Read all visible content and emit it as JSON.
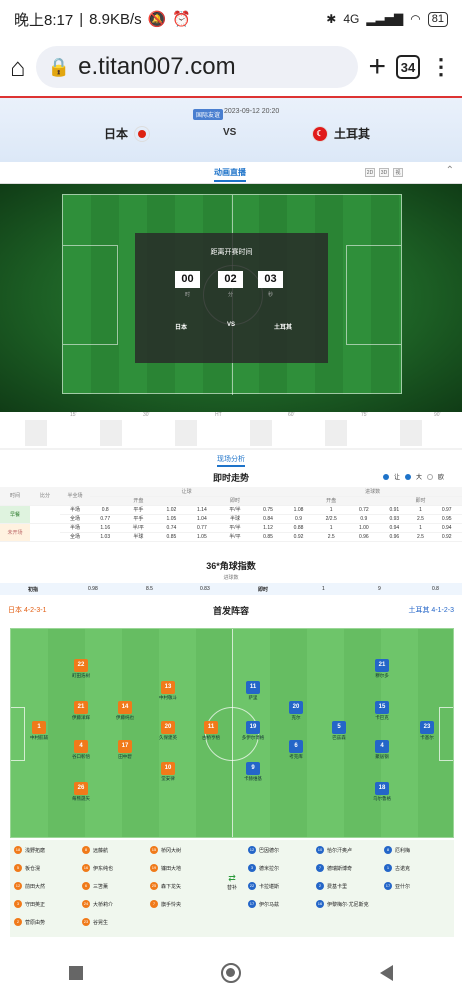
{
  "status_bar": {
    "time": "晚上8:17",
    "speed": "8.9KB/s",
    "network": "4G",
    "battery": "81"
  },
  "browser": {
    "url": "e.titan007.com",
    "tab_count": "34"
  },
  "match": {
    "league": "国际友谊",
    "datetime": "2023-09-12 20:20",
    "home": "日本",
    "away": "土耳其",
    "vs": "VS"
  },
  "live": {
    "tab": "动画直播",
    "view_buttons": [
      "2D",
      "3D",
      "视"
    ]
  },
  "countdown": {
    "title": "距离开赛时间",
    "boxes": [
      {
        "value": "00",
        "unit": "时"
      },
      {
        "value": "02",
        "unit": "分"
      },
      {
        "value": "03",
        "unit": "秒"
      }
    ],
    "home": "日本",
    "vs": "VS",
    "away": "土耳其"
  },
  "timeline_ticks": [
    "15'",
    "30'",
    "HT",
    "60'",
    "75'",
    "90'"
  ],
  "analysis": {
    "tab": "现场分析",
    "title": "即时走势",
    "radios": [
      {
        "label": "让",
        "on": true
      },
      {
        "label": "大",
        "on": true
      },
      {
        "label": "欧",
        "on": false
      }
    ],
    "head1": [
      "时间",
      "比分",
      "半全场",
      "让球",
      "进球数"
    ],
    "head2": [
      "开盘",
      "即时",
      "开盘",
      "即时"
    ],
    "rows": [
      {
        "phase": "早餐",
        "half": "半场",
        "cells": [
          "0.8",
          "平手",
          "1.02",
          "1.14",
          "平/半",
          "0.75",
          "1.08",
          "1",
          "0.72",
          "0.91",
          "1",
          "0.97"
        ]
      },
      {
        "phase": "",
        "half": "全场",
        "cells": [
          "0.77",
          "平手",
          "1.05",
          "1.04",
          "半球",
          "0.84",
          "0.9",
          "2/2.5",
          "0.9",
          "0.93",
          "2.5",
          "0.95"
        ]
      },
      {
        "phase": "未开场",
        "half": "半场",
        "cells": [
          "1.16",
          "半/平",
          "0.74",
          "0.77",
          "平/半",
          "1.12",
          "0.88",
          "1",
          "1.00",
          "0.94",
          "1",
          "0.94"
        ]
      },
      {
        "phase": "",
        "half": "全场",
        "cells": [
          "1.03",
          "半球",
          "0.85",
          "1.05",
          "半/平",
          "0.85",
          "0.92",
          "2.5",
          "0.96",
          "0.96",
          "2.5",
          "0.92"
        ]
      }
    ]
  },
  "corner": {
    "title": "36*角球指数",
    "sub": "进球数",
    "row": {
      "label1": "初指",
      "v": [
        "0.98",
        "8.5",
        "0.83"
      ],
      "label2": "即时",
      "w": [
        "1",
        "9",
        "0.8"
      ]
    }
  },
  "lineup": {
    "title": "首发阵容",
    "home_formation": "日本 4-2-3-1",
    "away_formation": "土耳其 4-1-2-3",
    "home_players": [
      {
        "n": "1",
        "name": "中村航辅"
      },
      {
        "n": "21",
        "name": "伊藤洋辉"
      },
      {
        "n": "4",
        "name": "谷口彰悟"
      },
      {
        "n": "22",
        "name": "町田浩树"
      },
      {
        "n": "26",
        "name": "毎熊晟矢"
      },
      {
        "n": "14",
        "name": "伊藤纯也"
      },
      {
        "n": "17",
        "name": "田中碧"
      },
      {
        "n": "13",
        "name": "中村敬斗"
      },
      {
        "n": "20",
        "name": "久保建英"
      },
      {
        "n": "10",
        "name": "堂安律"
      },
      {
        "n": "11",
        "name": "古桥亨梧"
      }
    ],
    "away_players": [
      {
        "n": "23",
        "name": "卡基尔"
      },
      {
        "n": "21",
        "name": "穆尔多"
      },
      {
        "n": "15",
        "name": "卡巴克"
      },
      {
        "n": "4",
        "name": "聚居钢"
      },
      {
        "n": "18",
        "name": "乌尔鲁格"
      },
      {
        "n": "5",
        "name": "巴兹森"
      },
      {
        "n": "20",
        "name": "克尔"
      },
      {
        "n": "6",
        "name": "考克库"
      },
      {
        "n": "11",
        "name": "萨里"
      },
      {
        "n": "19",
        "name": "多伊尔博格"
      },
      {
        "n": "9",
        "name": "卡赫维基"
      }
    ],
    "subs_label": "替补",
    "home_subs": [
      {
        "n": "18",
        "name": "浅野拓磨"
      },
      {
        "n": "8",
        "name": "远藤航"
      },
      {
        "n": "15",
        "name": "桥冈大树"
      },
      {
        "n": "5",
        "name": "板仓滉"
      },
      {
        "n": "16",
        "name": "伊东纯也"
      },
      {
        "n": "19",
        "name": "镰田大地"
      },
      {
        "n": "12",
        "name": "前田大然"
      },
      {
        "n": "6",
        "name": "三笘薰"
      },
      {
        "n": "25",
        "name": "森下龙矢"
      },
      {
        "n": "3",
        "name": "守田英正"
      },
      {
        "n": "24",
        "name": "大桥莉介"
      },
      {
        "n": "7",
        "name": "旗手怜央"
      },
      {
        "n": "2",
        "name": "菅原由势"
      },
      {
        "n": "23",
        "name": "谷晃生"
      }
    ],
    "away_subs": [
      {
        "n": "12",
        "name": "巴因德尔"
      },
      {
        "n": "10",
        "name": "恰尔汗奥卢"
      },
      {
        "n": "8",
        "name": "厄利梅"
      },
      {
        "n": "3",
        "name": "德米拉尔"
      },
      {
        "n": "7",
        "name": "德瑞斯博奇"
      },
      {
        "n": "1",
        "name": "古诺克"
      },
      {
        "n": "22",
        "name": "卡拉堪斯"
      },
      {
        "n": "2",
        "name": "费基卡里"
      },
      {
        "n": "17",
        "name": "亚什尔"
      },
      {
        "n": "17",
        "name": "伊尔马兹"
      },
      {
        "n": "16",
        "name": "伊黎梅尔·尤尼斯克"
      }
    ]
  }
}
